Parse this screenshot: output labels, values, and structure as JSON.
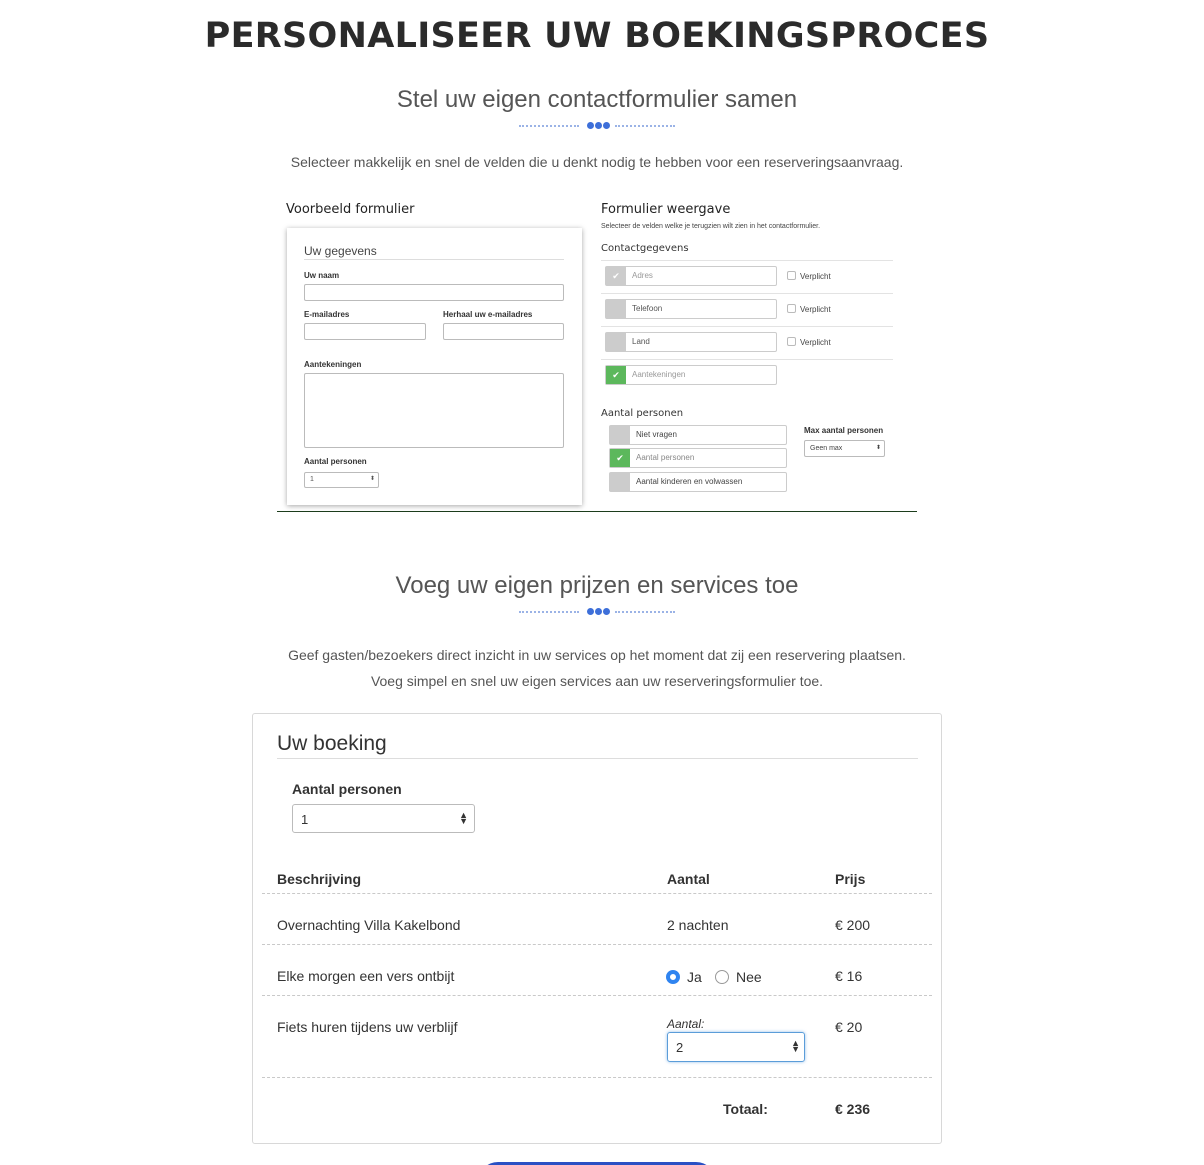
{
  "page_title": "PERSONALISEER UW BOEKINGSPROCES",
  "section1": {
    "heading": "Stel uw eigen contactformulier samen",
    "description": "Selecteer makkelijk en snel de velden die u denkt nodig te hebben voor een reserveringsaanvraag."
  },
  "example_form": {
    "title": "Voorbeeld formulier",
    "card_title": "Uw gegevens",
    "name_label": "Uw naam",
    "email_label": "E-mailadres",
    "email_repeat_label": "Herhaal uw e-mailadres",
    "notes_label": "Aantekeningen",
    "persons_label": "Aantal personen",
    "persons_value": "1"
  },
  "form_display": {
    "title": "Formulier weergave",
    "subtitle": "Selecteer de velden welke je terugzien wilt zien in het contactformulier.",
    "contact_heading": "Contactgegevens",
    "fields": [
      {
        "label": "Adres",
        "required_label": "Verplicht"
      },
      {
        "label": "Telefoon",
        "required_label": "Verplicht"
      },
      {
        "label": "Land",
        "required_label": "Verplicht"
      },
      {
        "label": "Aantekeningen",
        "checked": true
      }
    ],
    "persons_heading": "Aantal personen",
    "persons_options": [
      "Niet vragen",
      "Aantal personen",
      "Aantal kinderen en volwassen"
    ],
    "max_label": "Max aantal personen",
    "max_value": "Geen max",
    "check_glyph": "✔"
  },
  "section2": {
    "heading": "Voeg uw eigen prijzen en services toe",
    "description_line1": "Geef gasten/bezoekers direct inzicht in uw services op het moment dat zij een reservering plaatsen.",
    "description_line2": "Voeg simpel en snel uw eigen services aan uw reserveringsformulier toe."
  },
  "booking": {
    "title": "Uw boeking",
    "persons_label": "Aantal personen",
    "persons_value": "1",
    "columns": {
      "description": "Beschrijving",
      "quantity": "Aantal",
      "price": "Prijs"
    },
    "rows": [
      {
        "description": "Overnachting Villa Kakelbond",
        "quantity": "2 nachten",
        "price": "€ 200"
      },
      {
        "description": "Elke morgen een vers ontbijt",
        "option_yes": "Ja",
        "option_no": "Nee",
        "selected": "Ja",
        "price": "€ 16"
      },
      {
        "description": "Fiets huren tijdens uw verblijf",
        "quantity_label": "Aantal:",
        "quantity_value": "2",
        "price": "€ 20"
      }
    ],
    "total_label": "Totaal:",
    "total_value": "€ 236"
  },
  "colors": {
    "accent": "#3d6fd9",
    "check_green": "#5cb85c",
    "radio_blue": "#2f84f0",
    "cta": "#2a50c4"
  },
  "icons": {
    "select_arrows": "▲▼"
  }
}
